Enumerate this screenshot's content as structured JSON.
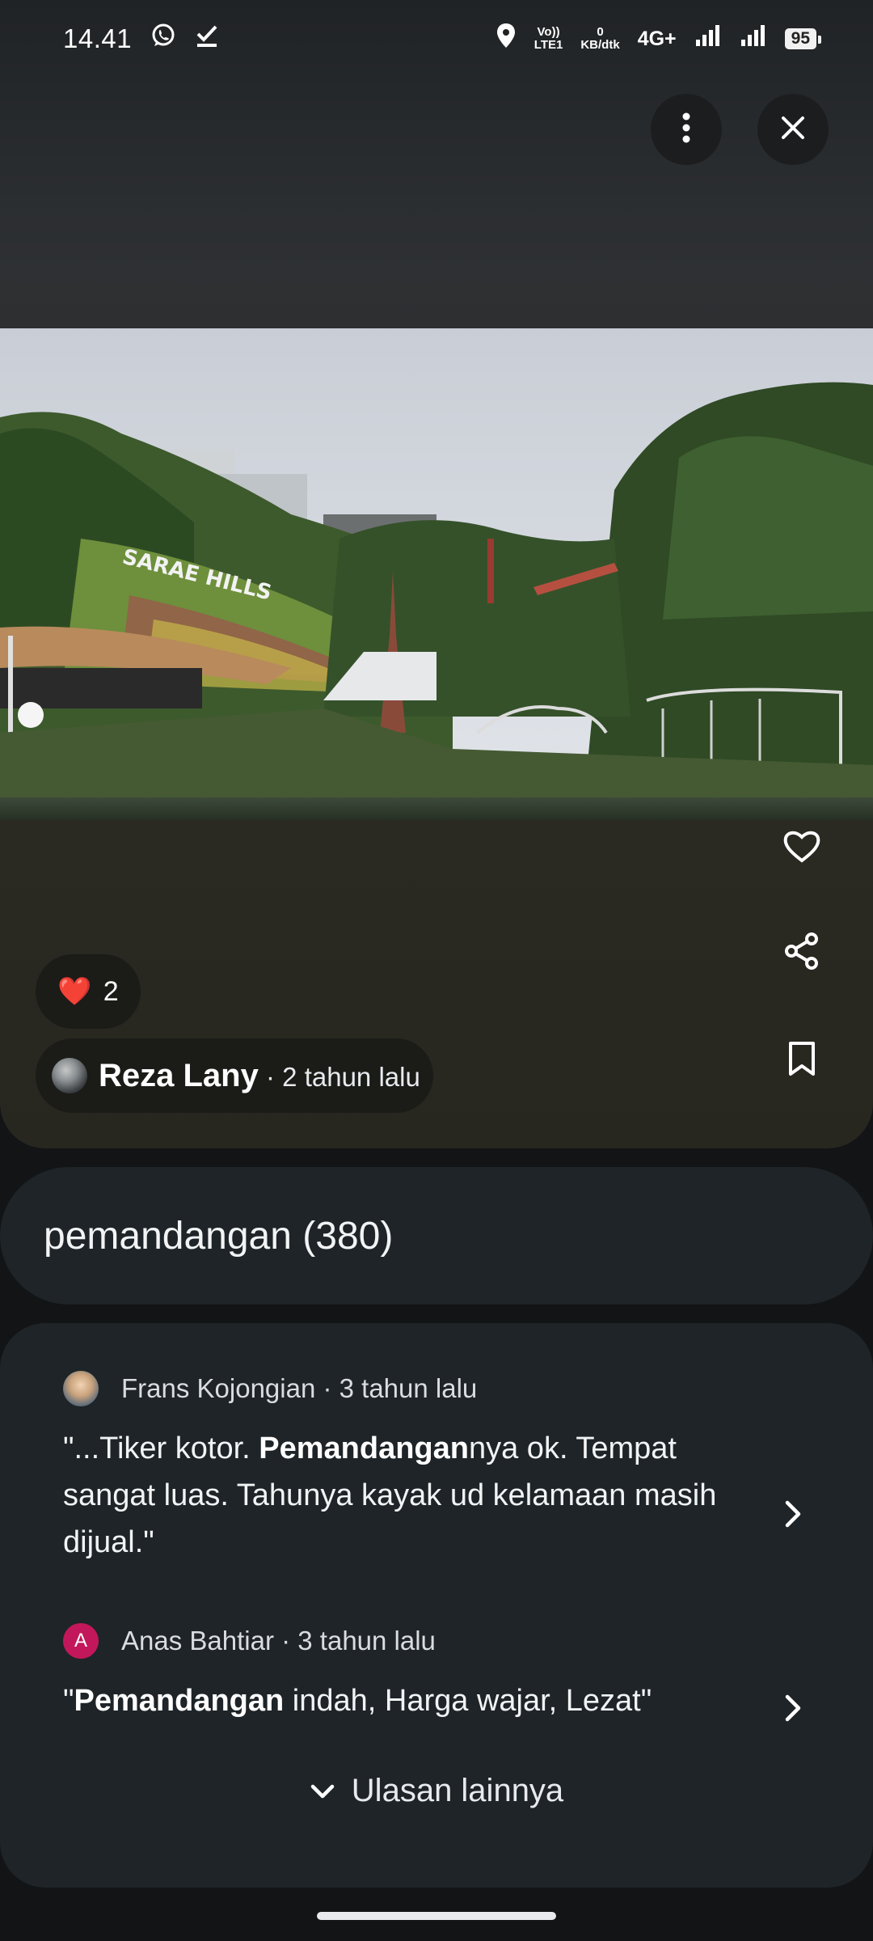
{
  "status_bar": {
    "time": "14.41",
    "volte": "Vo))",
    "lte": "LTE1",
    "speed_value": "0",
    "speed_unit": "KB/dtk",
    "network": "4G+",
    "battery": "95",
    "icons": [
      "whatsapp-icon",
      "check-download-icon",
      "location-icon",
      "signal-icon",
      "signal-icon"
    ]
  },
  "viewer": {
    "more_icon": "more-vert-icon",
    "close_icon": "close-icon",
    "photo_sign_text": "SARAE HILLS",
    "side_actions": [
      "heart-outline-icon",
      "share-icon",
      "bookmark-icon"
    ],
    "likes_emoji": "❤️",
    "likes_count": "2",
    "author_name": "Reza Lany",
    "author_time": " · 2 tahun lalu"
  },
  "topic": {
    "label": "pemandangan (380)"
  },
  "reviews": [
    {
      "author": "Frans Kojongian · 3 tahun lalu",
      "text_pre": "\"...Tiker kotor. ",
      "text_bold": "Pemandangan",
      "text_post": "nya ok. Tempat sangat luas. Tahunya kayak ud kelamaan masih dijual.\""
    },
    {
      "avatar_letter": "A",
      "author": "Anas Bahtiar · 3 tahun lalu",
      "text_pre": "\"",
      "text_bold": "Pemandangan",
      "text_post": " indah, Harga wajar, Lezat\""
    }
  ],
  "more_reviews_label": "Ulasan lainnya",
  "colors": {
    "background": "#121416",
    "card": "#1e2427",
    "like_heart": "#e53935",
    "avatar_letter_bg": "#c2185b"
  }
}
